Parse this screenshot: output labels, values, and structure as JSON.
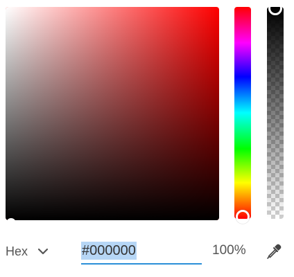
{
  "picker": {
    "hue_color": "#ff0000",
    "selected_color": "#000000"
  },
  "mode_select": {
    "label": "Hex",
    "icon": "chevron-down-icon"
  },
  "hex_input": {
    "value": "#000000"
  },
  "opacity": {
    "value": "100%"
  },
  "eyedropper": {
    "icon": "eyedropper-icon"
  },
  "colors": {
    "accent": "#2a8fd8",
    "selection": "#b6d6f5"
  }
}
